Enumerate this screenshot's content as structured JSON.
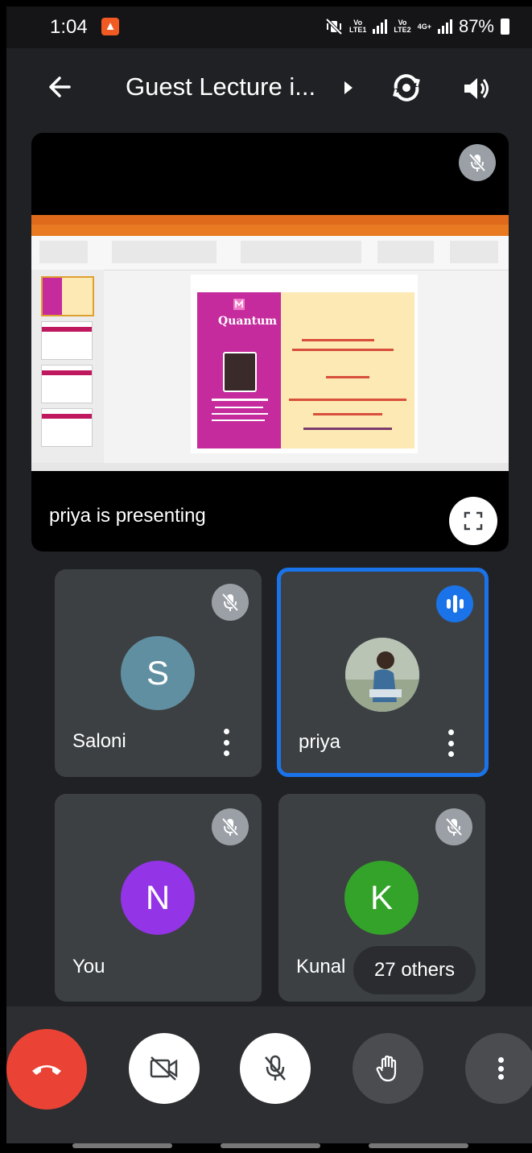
{
  "status_bar": {
    "time": "1:04",
    "notification_icon": "notification-app-icon",
    "sim1_label": "VoLTE1",
    "sim2_label": "VoLTE2",
    "network": "4G+",
    "battery": "87%"
  },
  "header": {
    "title": "Guest Lecture i...",
    "back_icon": "arrow-left-icon",
    "switch_camera_icon": "camera-flip-icon",
    "audio_icon": "speaker-icon"
  },
  "presentation": {
    "presenting_text": "priya is presenting",
    "muted_icon": "mic-off-icon",
    "fullscreen_icon": "fullscreen-icon"
  },
  "participants": [
    {
      "name": "Saloni",
      "initial": "S",
      "color": "#5f8fa1",
      "muted": true
    },
    {
      "name": "priya",
      "initial": "",
      "color": "#8aa6b5",
      "muted": false,
      "speaking": true
    },
    {
      "name": "You",
      "initial": "N",
      "color": "#9334e6",
      "muted": true
    },
    {
      "name": "Kunal",
      "initial": "K",
      "color": "#34a32a",
      "muted": true
    }
  ],
  "others_label": "27 others",
  "controls": {
    "end_call_icon": "phone-hangup-icon",
    "camera_icon": "video-off-icon",
    "mic_icon": "mic-off-icon",
    "raise_hand_icon": "hand-icon",
    "more_icon": "more-vertical-icon"
  },
  "colors": {
    "background": "#202124",
    "tile": "#3c4043",
    "active_border": "#1a73e8",
    "end_call": "#ea4335"
  }
}
